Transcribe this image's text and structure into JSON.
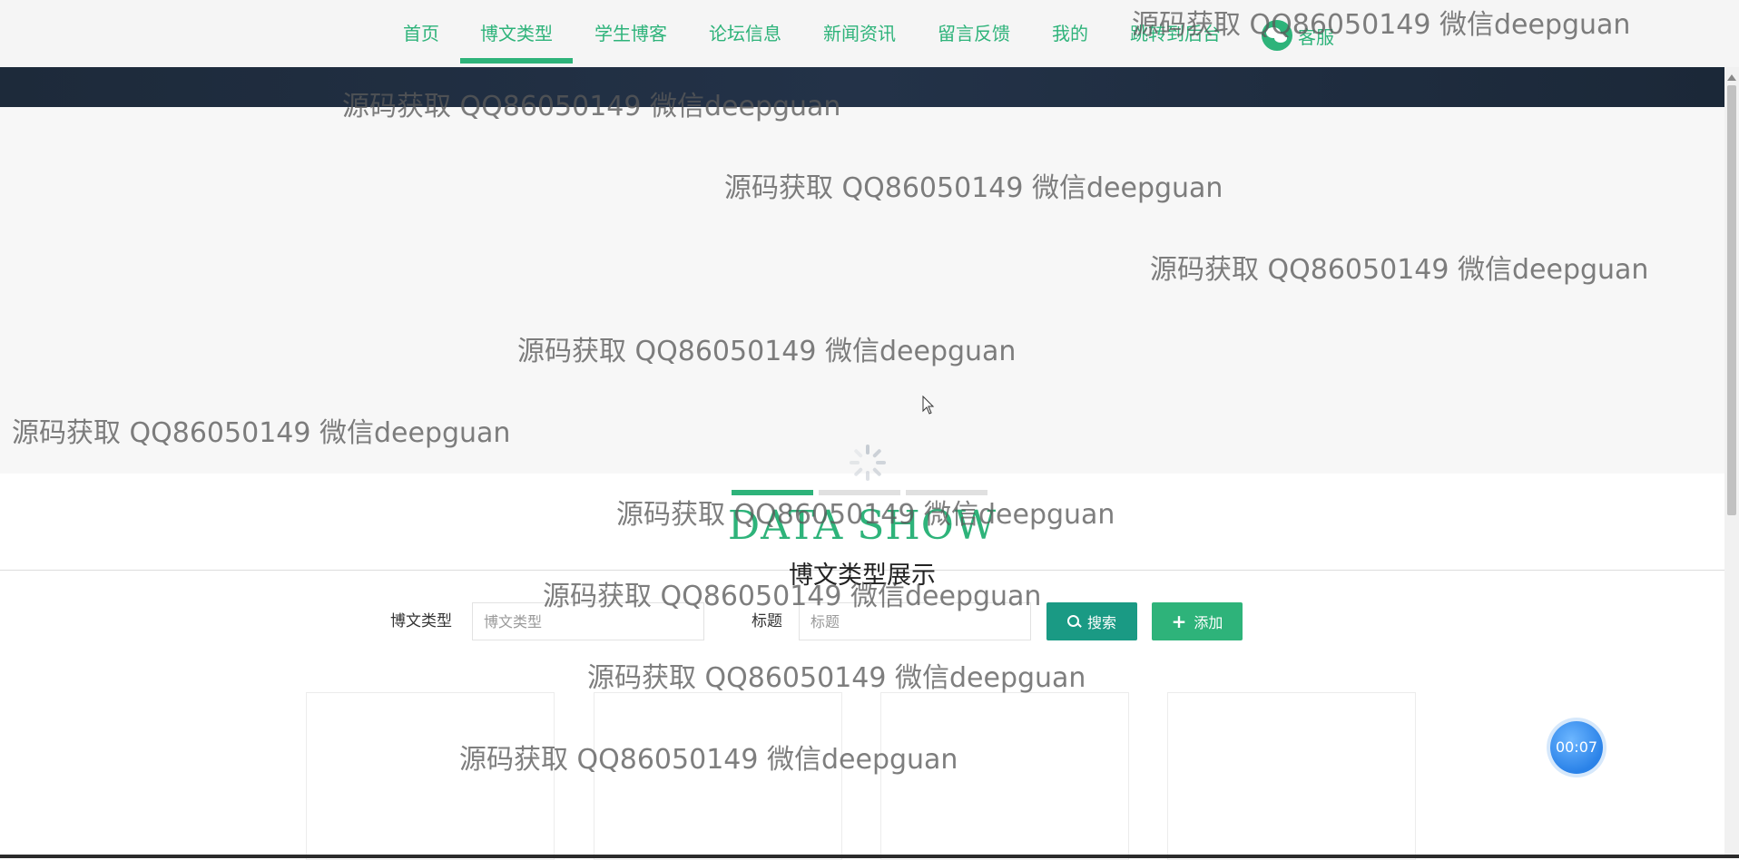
{
  "nav": {
    "items": [
      {
        "label": "首页"
      },
      {
        "label": "博文类型"
      },
      {
        "label": "学生博客"
      },
      {
        "label": "论坛信息"
      },
      {
        "label": "新闻资讯"
      },
      {
        "label": "留言反馈"
      },
      {
        "label": "我的"
      },
      {
        "label": "跳转到后台"
      }
    ],
    "active_index": 1,
    "service_label": "客服"
  },
  "colors": {
    "accent": "#2eb37a",
    "search_button": "#1a9a84",
    "banner": "#1d2a3a",
    "timer": "#2a82e8"
  },
  "section": {
    "title": "DATA SHOW",
    "subtitle": "博文类型展示"
  },
  "search": {
    "type_label": "博文类型",
    "type_placeholder": "博文类型",
    "title_label": "标题",
    "title_placeholder": "标题",
    "search_button": "搜索",
    "add_button": "添加"
  },
  "timer": "00:07",
  "watermark": "源码获取 QQ86050149 微信deepguan"
}
